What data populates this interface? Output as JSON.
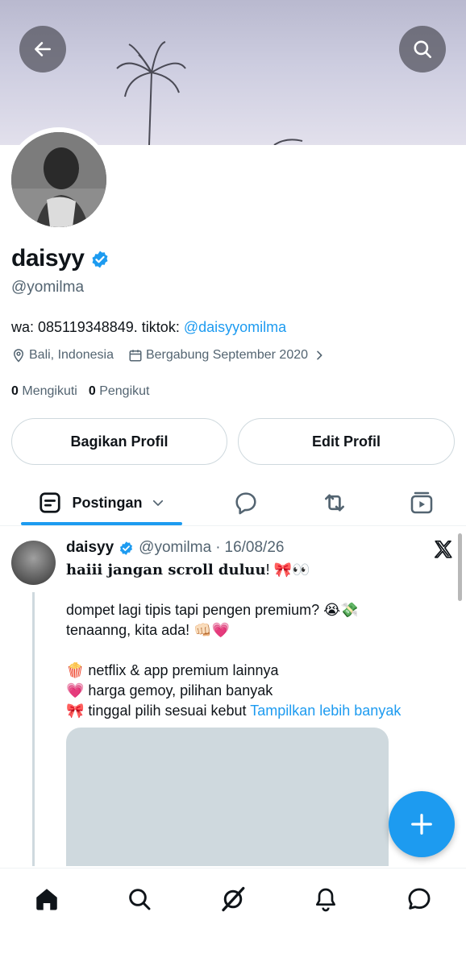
{
  "header": {
    "back_icon": "arrow-left-icon",
    "search_icon": "search-icon"
  },
  "profile": {
    "display_name": "daisyy",
    "handle": "@yomilma",
    "bio_text": "wa: 085119348849. tiktok: ",
    "bio_link": "@daisyyomilma",
    "location": "Bali, Indonesia",
    "joined": "Bergabung September 2020",
    "following_count": "0",
    "following_label": "Mengikuti",
    "followers_count": "0",
    "followers_label": "Pengikut",
    "verified_color": "#1d9bf0"
  },
  "actions": {
    "share_label": "Bagikan Profil",
    "edit_label": "Edit Profil"
  },
  "tabs": {
    "posts_label": "Postingan"
  },
  "post": {
    "name": "daisyy",
    "handle": "@yomilma",
    "separator": "·",
    "date": "16/08/26",
    "line1": "haiii jangan scroll duluu",
    "line1_tail": "! 🎀👀",
    "line2": "dompet lagi tipis tapi pengen premium? 😭💸",
    "line3": "tenaanng, kita ada! 👊🏻💗",
    "line4": "🍿 netflix & app premium lainnya",
    "line5": "💗 harga gemoy, pilihan banyak",
    "line6": "🎀 tinggal pilih sesuai kebut ",
    "show_more": "Tampilkan lebih banyak"
  },
  "colors": {
    "accent": "#1d9bf0",
    "text_primary": "#0f1419",
    "text_secondary": "#536471"
  }
}
